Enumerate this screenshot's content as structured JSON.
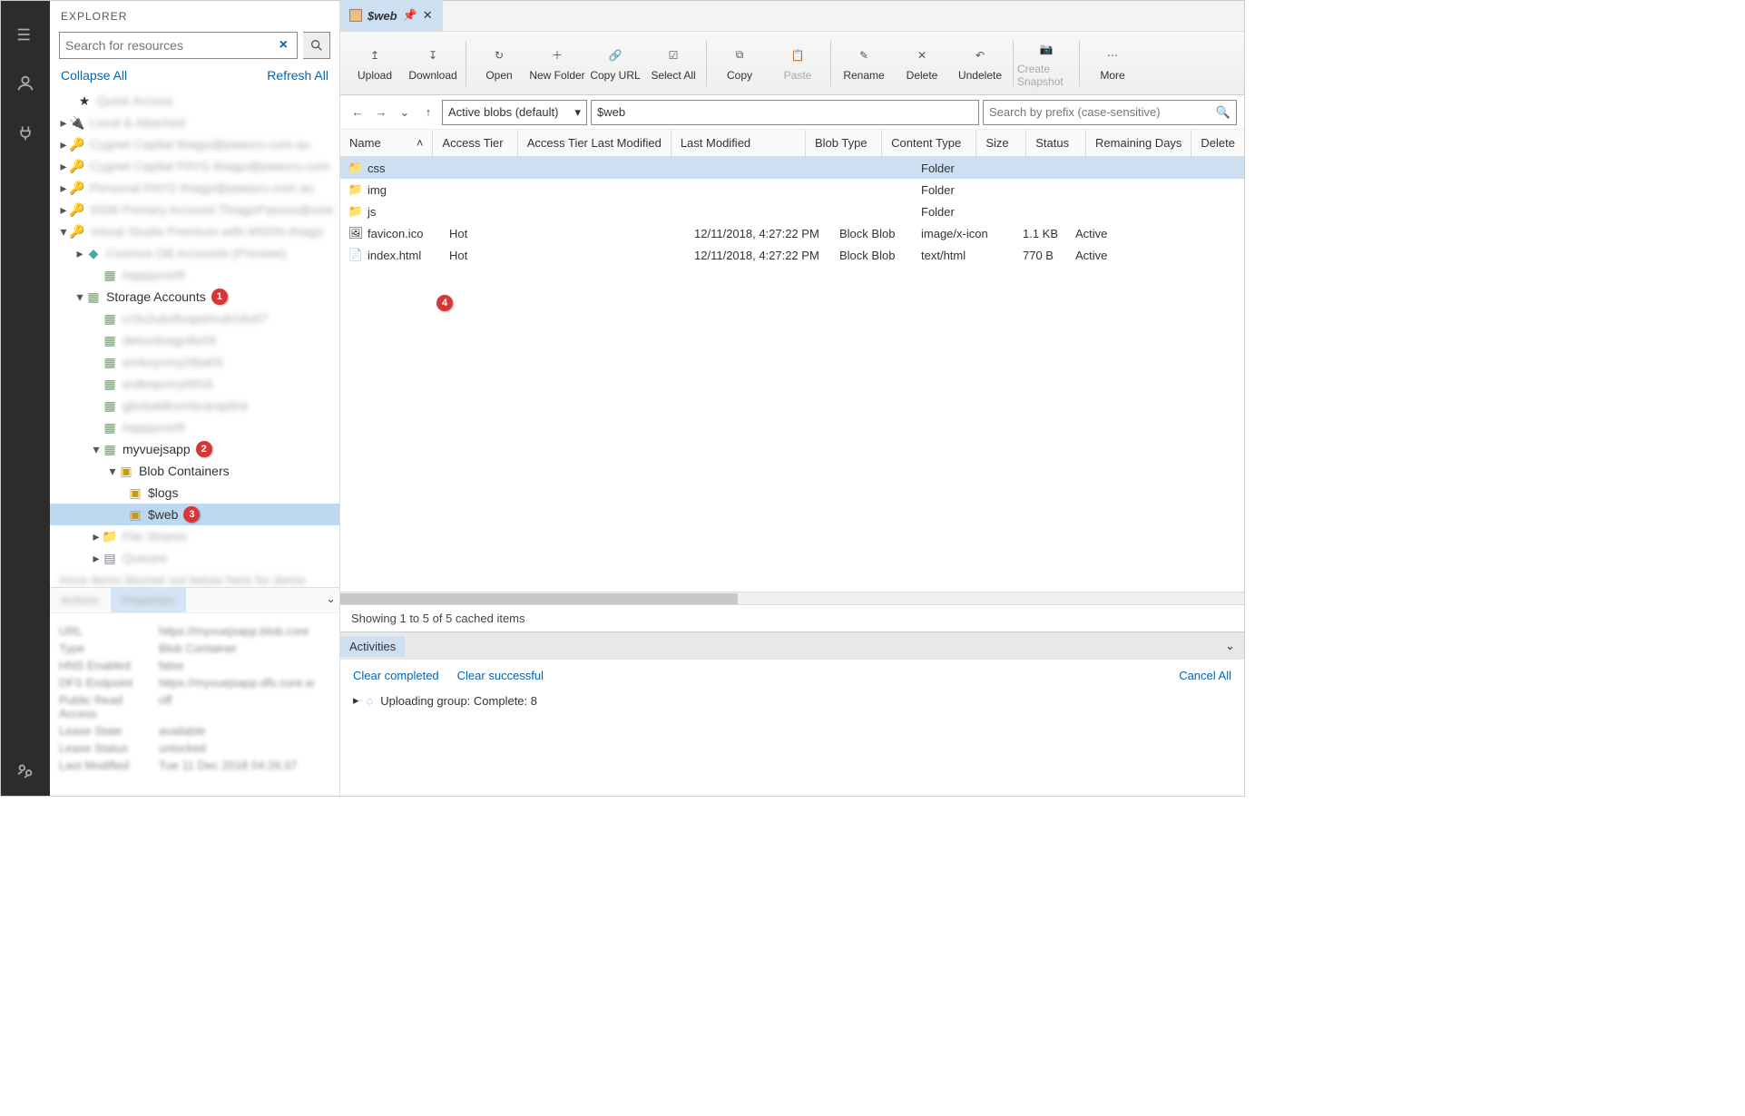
{
  "sidebar": {
    "title": "EXPLORER",
    "search_placeholder": "Search for resources",
    "collapse_label": "Collapse All",
    "refresh_label": "Refresh All",
    "storage_accounts_label": "Storage Accounts",
    "myvuejsapp_label": "myvuejsapp",
    "blob_containers_label": "Blob Containers",
    "logs_label": "$logs",
    "web_label": "$web",
    "badges": {
      "b1": "1",
      "b2": "2",
      "b3": "3",
      "b4": "4"
    }
  },
  "props": {
    "tab_actions": "Actions",
    "tab_properties": "Properties"
  },
  "tab": {
    "title": "$web"
  },
  "toolbar": {
    "upload": "Upload",
    "download": "Download",
    "open": "Open",
    "newfolder": "New Folder",
    "copyurl": "Copy URL",
    "selectall": "Select All",
    "copy": "Copy",
    "paste": "Paste",
    "rename": "Rename",
    "delete": "Delete",
    "undelete": "Undelete",
    "snapshot": "Create Snapshot",
    "more": "More"
  },
  "nav": {
    "dropdown": "Active blobs (default)",
    "path": "$web",
    "prefix_placeholder": "Search by prefix (case-sensitive)"
  },
  "columns": {
    "name": "Name",
    "tier": "Access Tier",
    "tiermod": "Access Tier Last Modified",
    "mod": "Last Modified",
    "btype": "Blob Type",
    "ctype": "Content Type",
    "size": "Size",
    "status": "Status",
    "remain": "Remaining Days",
    "delete": "Delete"
  },
  "rows": [
    {
      "name": "css",
      "tier": "",
      "tiermod": "",
      "mod": "",
      "btype": "",
      "ctype": "Folder",
      "size": "",
      "status": "",
      "icon": "folder"
    },
    {
      "name": "img",
      "tier": "",
      "tiermod": "",
      "mod": "",
      "btype": "",
      "ctype": "Folder",
      "size": "",
      "status": "",
      "icon": "folder"
    },
    {
      "name": "js",
      "tier": "",
      "tiermod": "",
      "mod": "",
      "btype": "",
      "ctype": "Folder",
      "size": "",
      "status": "",
      "icon": "folder"
    },
    {
      "name": "favicon.ico",
      "tier": "Hot",
      "tiermod": "",
      "mod": "12/11/2018, 4:27:22 PM",
      "btype": "Block Blob",
      "ctype": "image/x-icon",
      "size": "1.1 KB",
      "status": "Active",
      "icon": "image"
    },
    {
      "name": "index.html",
      "tier": "Hot",
      "tiermod": "",
      "mod": "12/11/2018, 4:27:22 PM",
      "btype": "Block Blob",
      "ctype": "text/html",
      "size": "770 B",
      "status": "Active",
      "icon": "file"
    }
  ],
  "status": "Showing 1 to 5 of 5 cached items",
  "activities": {
    "title": "Activities",
    "clear_completed": "Clear completed",
    "clear_successful": "Clear successful",
    "upload_msg": "Uploading group: Complete: 8",
    "cancel_all": "Cancel All"
  }
}
